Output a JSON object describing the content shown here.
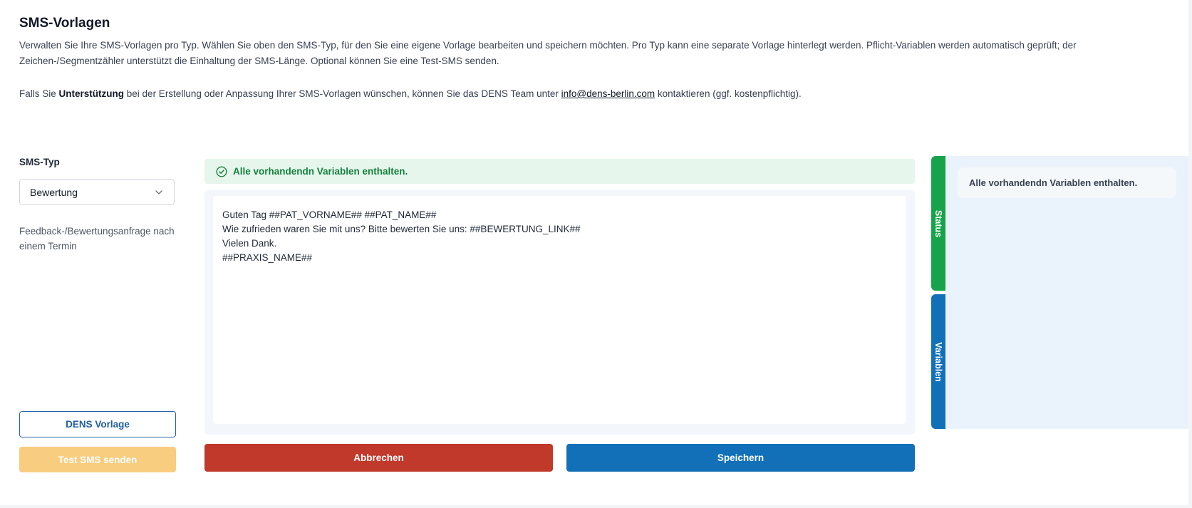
{
  "header": {
    "title": "SMS-Vorlagen",
    "description": "Verwalten Sie Ihre SMS-Vorlagen pro Typ. Wählen Sie oben den SMS-Typ, für den Sie eine eigene Vorlage bearbeiten und speichern möchten. Pro Typ kann eine separate Vorlage hinterlegt werden. Pflicht-Variablen werden automatisch geprüft; der Zeichen-/Segmentzähler unterstützt die Einhaltung der SMS-Länge. Optional können Sie eine Test-SMS senden.",
    "support_prefix": "Falls Sie ",
    "support_bold": "Unterstützung",
    "support_middle": " bei der Erstellung oder Anpassung Ihrer SMS-Vorlagen wünschen, können Sie das DENS Team unter ",
    "support_email": "info@dens-berlin.com",
    "support_suffix": " kontaktieren (ggf. kostenpflichtig)."
  },
  "left": {
    "sms_type_label": "SMS-Typ",
    "selected_type": "Bewertung",
    "type_description": "Feedback-/Bewertungsanfrage nach einem Termin",
    "dens_template_button": "DENS Vorlage",
    "test_sms_button": "Test SMS senden"
  },
  "editor": {
    "status_message": "Alle vorhandendn Variablen enthalten.",
    "template_text": "Guten Tag ##PAT_VORNAME## ##PAT_NAME##\nWie zufrieden waren Sie mit uns? Bitte bewerten Sie uns: ##BEWERTUNG_LINK##\nVielen Dank.\n##PRAXIS_NAME##",
    "cancel_button": "Abbrechen",
    "save_button": "Speichern"
  },
  "side": {
    "tab_status": "Status",
    "tab_variables": "Variablen",
    "panel_message": "Alle vorhandendn Variablen enthalten."
  },
  "colors": {
    "success": "#15803d",
    "danger": "#c0392b",
    "primary": "#1170b8",
    "warning_disabled": "#f8cd7f"
  }
}
